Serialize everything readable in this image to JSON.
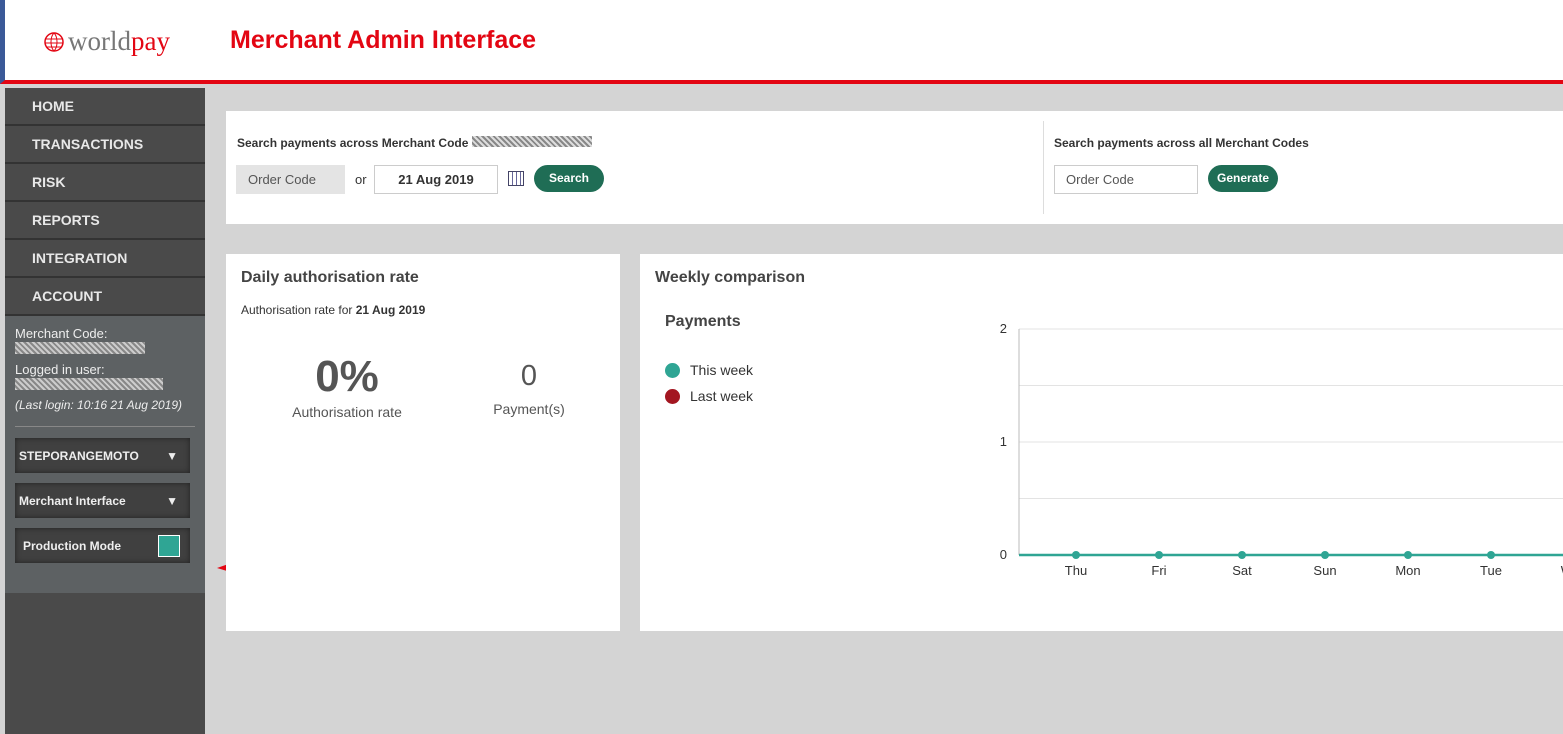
{
  "header": {
    "logo": {
      "a": "world",
      "b": "pay"
    },
    "title": "Merchant Admin Interface"
  },
  "nav": [
    "HOME",
    "TRANSACTIONS",
    "RISK",
    "REPORTS",
    "INTEGRATION",
    "ACCOUNT"
  ],
  "info": {
    "merchant_code_label": "Merchant Code:",
    "logged_user_label": "Logged in user:",
    "last_login": "(Last login: 10:16 21 Aug 2019)",
    "merchant_select": "STEPORANGEMOTO",
    "interface_select": "Merchant Interface",
    "production_mode_label": "Production Mode",
    "production_mode_color": "#2fa594"
  },
  "search": {
    "label": "Search payments across Merchant Code",
    "order_placeholder": "Order Code",
    "or": "or",
    "date": "21 Aug 2019",
    "search_btn": "Search",
    "all_label": "Search payments across all Merchant Codes",
    "all_placeholder": "Order Code",
    "generate_btn": "Generate"
  },
  "daily": {
    "title": "Daily authorisation rate",
    "sub_prefix": "Authorisation rate for ",
    "sub_date": "21 Aug 2019",
    "rate": "0%",
    "rate_label": "Authorisation rate",
    "payments": "0",
    "payments_label": "Payment(s)"
  },
  "weekly": {
    "title": "Weekly comparison",
    "subtitle": "Payments"
  },
  "chart_data": {
    "type": "line",
    "categories": [
      "Thu",
      "Fri",
      "Sat",
      "Sun",
      "Mon",
      "Tue",
      "Wed"
    ],
    "ylim": [
      0,
      2
    ],
    "yticks": [
      "0",
      "1",
      "2"
    ],
    "grid": true,
    "legend": "left",
    "series": [
      {
        "name": "This week",
        "color": "#2fa594",
        "values": [
          0,
          0,
          0,
          0,
          0,
          0,
          0
        ]
      },
      {
        "name": "Last week",
        "color": "#a31621",
        "values": []
      }
    ]
  }
}
